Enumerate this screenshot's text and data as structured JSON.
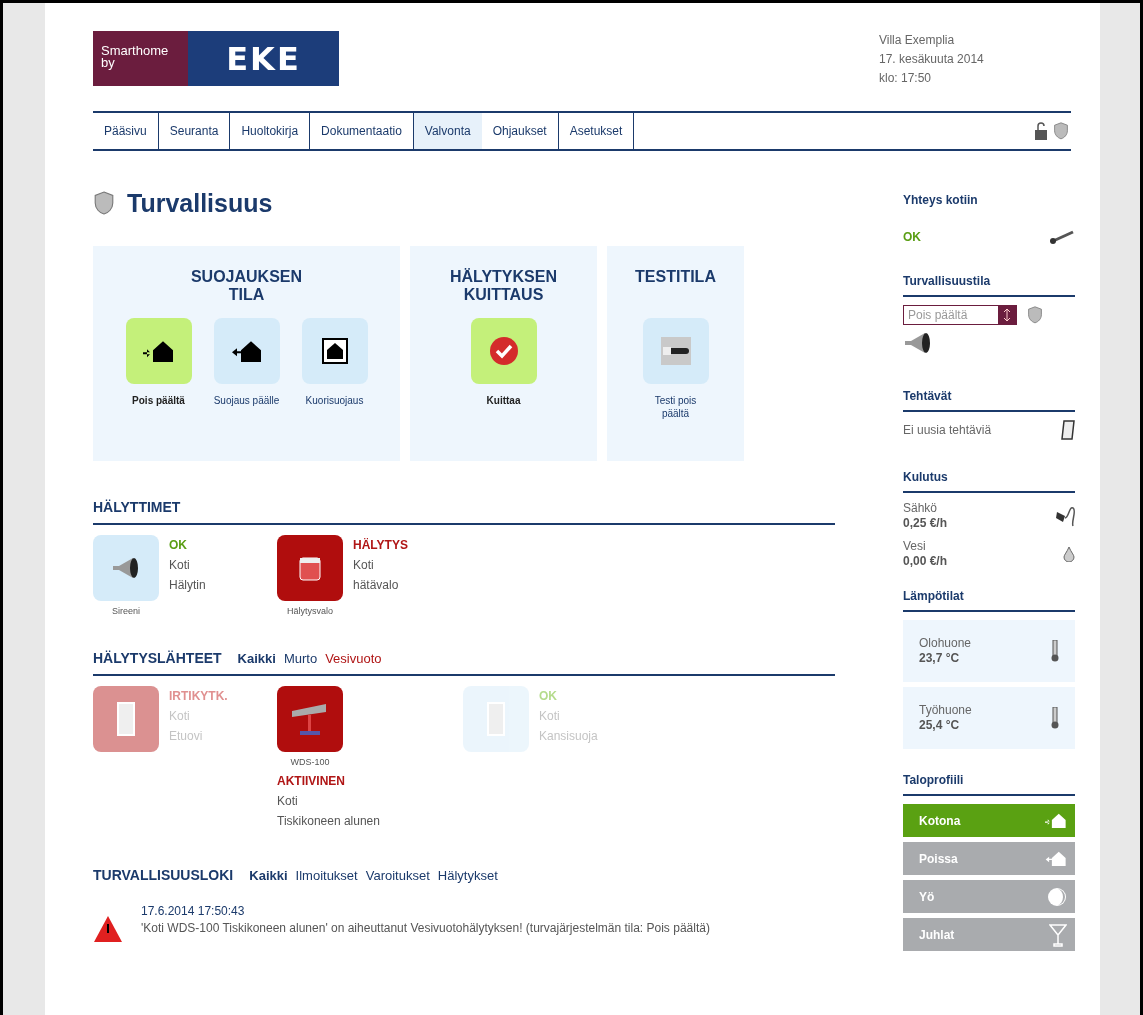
{
  "logo": {
    "line1": "Smarthome",
    "line2": "by",
    "brand": "EKE"
  },
  "header_info": [
    "Villa Exemplia",
    "17. kesäkuuta 2014",
    "klo: 17:50"
  ],
  "nav": [
    {
      "label": "Pääsivu",
      "selected": false
    },
    {
      "label": "Seuranta",
      "selected": false
    },
    {
      "label": "Huoltokirja",
      "selected": false
    },
    {
      "label": "Dokumentaatio",
      "selected": false
    },
    {
      "label": "Valvonta",
      "selected": true
    },
    {
      "label": "Ohjaukset",
      "selected": false
    },
    {
      "label": "Asetukset",
      "selected": false
    }
  ],
  "page_title": "Turvallisuus",
  "panels": [
    {
      "title": "SUOJAUKSEN TILA",
      "buttons": [
        {
          "label": "Pois päältä",
          "selected": true,
          "kind": "arrive"
        },
        {
          "label": "Suojaus päälle",
          "selected": false,
          "kind": "leave"
        },
        {
          "label": "Kuorisuojaus",
          "selected": false,
          "kind": "perimeter"
        }
      ]
    },
    {
      "title": "HÄLYTYKSEN KUITTAUS",
      "buttons": [
        {
          "label": "Kuittaa",
          "selected": true,
          "kind": "acknowledge"
        }
      ]
    },
    {
      "title": "TESTITILA",
      "buttons": [
        {
          "label": "Testi pois päältä",
          "selected": false,
          "kind": "test"
        }
      ]
    }
  ],
  "alarms": {
    "title": "HÄLYTTIMET",
    "devices": [
      {
        "label": "Sireeni",
        "status": "OK",
        "color": "#5a9e14",
        "alarm": false,
        "place": "Koti",
        "name": "Hälytin",
        "kind": "siren"
      },
      {
        "label": "Hälytysvalo",
        "status": "HÄLYTYS",
        "color": "#b01515",
        "alarm": true,
        "place": "Koti",
        "name": "hätävalo",
        "kind": "lamp"
      }
    ]
  },
  "sources": {
    "title": "HÄLYTYSLÄHTEET",
    "filters": [
      {
        "label": "Kaikki",
        "selected": true,
        "alarm": false
      },
      {
        "label": "Murto",
        "selected": false,
        "alarm": false
      },
      {
        "label": "Vesivuoto",
        "selected": false,
        "alarm": true
      }
    ],
    "devices": [
      {
        "status": "IRTIKYTK.",
        "color": "#e09090",
        "alarm": true,
        "place": "Koti",
        "name": "Etuovi",
        "kind": "door",
        "disabled": true
      },
      {
        "label": "WDS-100",
        "status": "AKTIIVINEN",
        "color": "#b01515",
        "alarm": true,
        "place": "Koti",
        "name": "Tiskikoneen alunen",
        "kind": "sensor",
        "disabled": false
      },
      {
        "status": "OK",
        "color": "#b5db8c",
        "alarm": false,
        "place": "Koti",
        "name": "Kansisuoja",
        "kind": "door",
        "disabled": true
      }
    ]
  },
  "log": {
    "title": "TURVALLISUUSLOKI",
    "filters": [
      {
        "label": "Kaikki",
        "selected": true
      },
      {
        "label": "Ilmoitukset",
        "selected": false
      },
      {
        "label": "Varoitukset",
        "selected": false
      },
      {
        "label": "Hälytykset",
        "selected": false
      }
    ],
    "entries": [
      {
        "time": "17.6.2014 17:50:43",
        "message": "'Koti WDS-100 Tiskikoneen alunen' on aiheuttanut Vesivuotohälytyksen! (turvajärjestelmän tila: Pois päältä)",
        "kind": "alarm"
      }
    ]
  },
  "sidebar": {
    "connection": {
      "title": "Yhteys kotiin",
      "status": "OK"
    },
    "security": {
      "title": "Turvallisuustila",
      "value": "Pois päältä"
    },
    "tasks": {
      "title": "Tehtävät",
      "text": "Ei uusia tehtäviä"
    },
    "consumption": {
      "title": "Kulutus",
      "items": [
        {
          "name": "Sähkö",
          "value": "0,25 €/h",
          "kind": "electricity"
        },
        {
          "name": "Vesi",
          "value": "0,00 €/h",
          "kind": "water"
        }
      ]
    },
    "temperatures": {
      "title": "Lämpötilat",
      "items": [
        {
          "room": "Olohuone",
          "value": "23,7 °C"
        },
        {
          "room": "Työhuone",
          "value": "25,4 °C"
        }
      ]
    },
    "profiles": {
      "title": "Taloprofiili",
      "items": [
        {
          "label": "Kotona",
          "selected": true,
          "kind": "home"
        },
        {
          "label": "Poissa",
          "selected": false,
          "kind": "away"
        },
        {
          "label": "Yö",
          "selected": false,
          "kind": "night"
        },
        {
          "label": "Juhlat",
          "selected": false,
          "kind": "party"
        }
      ]
    }
  }
}
